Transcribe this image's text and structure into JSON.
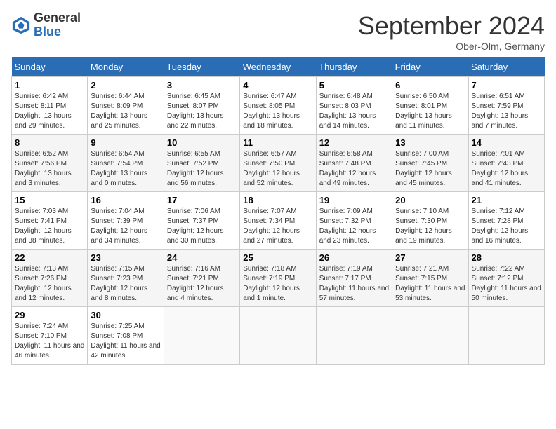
{
  "header": {
    "logo_general": "General",
    "logo_blue": "Blue",
    "title": "September 2024",
    "location": "Ober-Olm, Germany"
  },
  "columns": [
    "Sunday",
    "Monday",
    "Tuesday",
    "Wednesday",
    "Thursday",
    "Friday",
    "Saturday"
  ],
  "weeks": [
    [
      {
        "day": "1",
        "sunrise": "Sunrise: 6:42 AM",
        "sunset": "Sunset: 8:11 PM",
        "daylight": "Daylight: 13 hours and 29 minutes."
      },
      {
        "day": "2",
        "sunrise": "Sunrise: 6:44 AM",
        "sunset": "Sunset: 8:09 PM",
        "daylight": "Daylight: 13 hours and 25 minutes."
      },
      {
        "day": "3",
        "sunrise": "Sunrise: 6:45 AM",
        "sunset": "Sunset: 8:07 PM",
        "daylight": "Daylight: 13 hours and 22 minutes."
      },
      {
        "day": "4",
        "sunrise": "Sunrise: 6:47 AM",
        "sunset": "Sunset: 8:05 PM",
        "daylight": "Daylight: 13 hours and 18 minutes."
      },
      {
        "day": "5",
        "sunrise": "Sunrise: 6:48 AM",
        "sunset": "Sunset: 8:03 PM",
        "daylight": "Daylight: 13 hours and 14 minutes."
      },
      {
        "day": "6",
        "sunrise": "Sunrise: 6:50 AM",
        "sunset": "Sunset: 8:01 PM",
        "daylight": "Daylight: 13 hours and 11 minutes."
      },
      {
        "day": "7",
        "sunrise": "Sunrise: 6:51 AM",
        "sunset": "Sunset: 7:59 PM",
        "daylight": "Daylight: 13 hours and 7 minutes."
      }
    ],
    [
      {
        "day": "8",
        "sunrise": "Sunrise: 6:52 AM",
        "sunset": "Sunset: 7:56 PM",
        "daylight": "Daylight: 13 hours and 3 minutes."
      },
      {
        "day": "9",
        "sunrise": "Sunrise: 6:54 AM",
        "sunset": "Sunset: 7:54 PM",
        "daylight": "Daylight: 13 hours and 0 minutes."
      },
      {
        "day": "10",
        "sunrise": "Sunrise: 6:55 AM",
        "sunset": "Sunset: 7:52 PM",
        "daylight": "Daylight: 12 hours and 56 minutes."
      },
      {
        "day": "11",
        "sunrise": "Sunrise: 6:57 AM",
        "sunset": "Sunset: 7:50 PM",
        "daylight": "Daylight: 12 hours and 52 minutes."
      },
      {
        "day": "12",
        "sunrise": "Sunrise: 6:58 AM",
        "sunset": "Sunset: 7:48 PM",
        "daylight": "Daylight: 12 hours and 49 minutes."
      },
      {
        "day": "13",
        "sunrise": "Sunrise: 7:00 AM",
        "sunset": "Sunset: 7:45 PM",
        "daylight": "Daylight: 12 hours and 45 minutes."
      },
      {
        "day": "14",
        "sunrise": "Sunrise: 7:01 AM",
        "sunset": "Sunset: 7:43 PM",
        "daylight": "Daylight: 12 hours and 41 minutes."
      }
    ],
    [
      {
        "day": "15",
        "sunrise": "Sunrise: 7:03 AM",
        "sunset": "Sunset: 7:41 PM",
        "daylight": "Daylight: 12 hours and 38 minutes."
      },
      {
        "day": "16",
        "sunrise": "Sunrise: 7:04 AM",
        "sunset": "Sunset: 7:39 PM",
        "daylight": "Daylight: 12 hours and 34 minutes."
      },
      {
        "day": "17",
        "sunrise": "Sunrise: 7:06 AM",
        "sunset": "Sunset: 7:37 PM",
        "daylight": "Daylight: 12 hours and 30 minutes."
      },
      {
        "day": "18",
        "sunrise": "Sunrise: 7:07 AM",
        "sunset": "Sunset: 7:34 PM",
        "daylight": "Daylight: 12 hours and 27 minutes."
      },
      {
        "day": "19",
        "sunrise": "Sunrise: 7:09 AM",
        "sunset": "Sunset: 7:32 PM",
        "daylight": "Daylight: 12 hours and 23 minutes."
      },
      {
        "day": "20",
        "sunrise": "Sunrise: 7:10 AM",
        "sunset": "Sunset: 7:30 PM",
        "daylight": "Daylight: 12 hours and 19 minutes."
      },
      {
        "day": "21",
        "sunrise": "Sunrise: 7:12 AM",
        "sunset": "Sunset: 7:28 PM",
        "daylight": "Daylight: 12 hours and 16 minutes."
      }
    ],
    [
      {
        "day": "22",
        "sunrise": "Sunrise: 7:13 AM",
        "sunset": "Sunset: 7:26 PM",
        "daylight": "Daylight: 12 hours and 12 minutes."
      },
      {
        "day": "23",
        "sunrise": "Sunrise: 7:15 AM",
        "sunset": "Sunset: 7:23 PM",
        "daylight": "Daylight: 12 hours and 8 minutes."
      },
      {
        "day": "24",
        "sunrise": "Sunrise: 7:16 AM",
        "sunset": "Sunset: 7:21 PM",
        "daylight": "Daylight: 12 hours and 4 minutes."
      },
      {
        "day": "25",
        "sunrise": "Sunrise: 7:18 AM",
        "sunset": "Sunset: 7:19 PM",
        "daylight": "Daylight: 12 hours and 1 minute."
      },
      {
        "day": "26",
        "sunrise": "Sunrise: 7:19 AM",
        "sunset": "Sunset: 7:17 PM",
        "daylight": "Daylight: 11 hours and 57 minutes."
      },
      {
        "day": "27",
        "sunrise": "Sunrise: 7:21 AM",
        "sunset": "Sunset: 7:15 PM",
        "daylight": "Daylight: 11 hours and 53 minutes."
      },
      {
        "day": "28",
        "sunrise": "Sunrise: 7:22 AM",
        "sunset": "Sunset: 7:12 PM",
        "daylight": "Daylight: 11 hours and 50 minutes."
      }
    ],
    [
      {
        "day": "29",
        "sunrise": "Sunrise: 7:24 AM",
        "sunset": "Sunset: 7:10 PM",
        "daylight": "Daylight: 11 hours and 46 minutes."
      },
      {
        "day": "30",
        "sunrise": "Sunrise: 7:25 AM",
        "sunset": "Sunset: 7:08 PM",
        "daylight": "Daylight: 11 hours and 42 minutes."
      },
      null,
      null,
      null,
      null,
      null
    ]
  ]
}
